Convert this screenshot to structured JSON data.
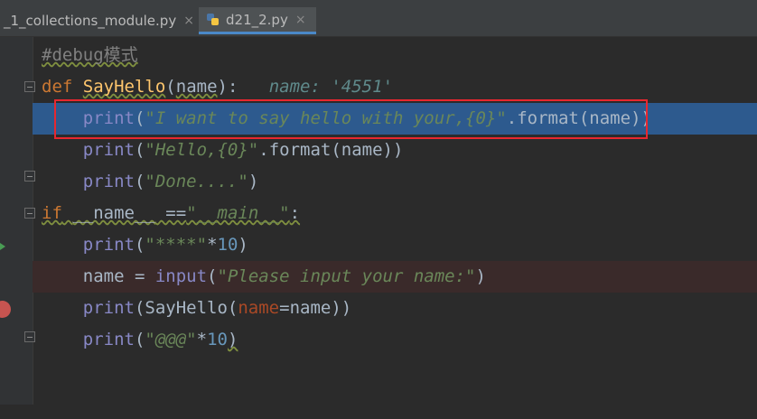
{
  "tabs": [
    {
      "label": "_1_collections_module.py",
      "close": "×",
      "active": false
    },
    {
      "label": "d21_2.py",
      "close": "×",
      "active": true
    }
  ],
  "code": {
    "l1": {
      "comment": "#debug模式"
    },
    "l2": {
      "kw": "def",
      "fn": "SayHello",
      "open": "(",
      "param": "name",
      "close": "):",
      "hint": "name: '4551'"
    },
    "l3": {
      "call": "print",
      "open": "(",
      "str": "\"I want to say hello with your,{0}\"",
      "rest": ".format(name))"
    },
    "l4": {
      "call": "print",
      "open": "(",
      "str": "\"Hello,{0}\"",
      "rest": ".format(name))"
    },
    "l5": {
      "call": "print",
      "open": "(",
      "str": "\"Done....\"",
      "close": ")"
    },
    "l6": {
      "kw": "if",
      "name": "__name__",
      "op": " ==",
      "str": "\"__main__\"",
      "colon": ":"
    },
    "l7": {
      "call": "print",
      "open": "(",
      "str": "\"****\"",
      "op": "*",
      "num": "10",
      "close": ")"
    },
    "l8": {
      "var": "name = ",
      "call": "input",
      "open": "(",
      "str": "\"Please input your name:\"",
      "close": ")"
    },
    "l9": {
      "call": "print",
      "open": "(SayHello(",
      "kwarg": "name",
      "rest": "=name))"
    },
    "l10": {
      "call": "print",
      "open": "(",
      "str": "\"@@@\"",
      "op": "*",
      "num": "10",
      "close": ")"
    }
  },
  "colors": {
    "selection": "#2d5a8e",
    "breakpoint": "#c75450",
    "annotation_box": "#e8272f"
  }
}
